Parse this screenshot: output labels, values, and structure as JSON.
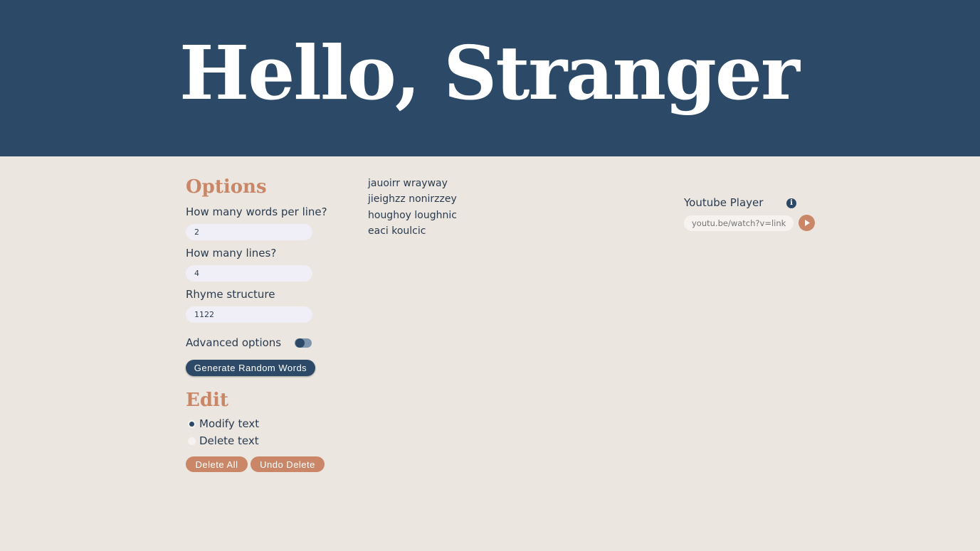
{
  "header": {
    "title": "Hello, Stranger"
  },
  "options": {
    "heading": "Options",
    "words_per_line": {
      "label": "How many words per line?",
      "value": "2"
    },
    "lines": {
      "label": "How many lines?",
      "value": "4"
    },
    "rhyme": {
      "label": "Rhyme structure",
      "value": "1122"
    },
    "advanced": {
      "label": "Advanced options",
      "enabled": false
    },
    "generate_label": "Generate Random Words"
  },
  "edit": {
    "heading": "Edit",
    "modes": [
      {
        "label": "Modify text",
        "selected": true
      },
      {
        "label": "Delete text",
        "selected": false
      }
    ],
    "delete_all_label": "Delete All",
    "undo_delete_label": "Undo Delete"
  },
  "generated": {
    "lines": [
      "jauoirr wrayway",
      "jieighzz nonirzzey",
      "houghoy loughnic",
      "eaci koulcic"
    ]
  },
  "youtube": {
    "title": "Youtube Player",
    "info_icon": "info-icon",
    "placeholder": "youtu.be/watch?v=link",
    "play_icon": "play-icon"
  },
  "colors": {
    "header_bg": "#2c4a67",
    "page_bg": "#ebe6e0",
    "accent": "#c98767",
    "text": "#2a3b4f"
  }
}
